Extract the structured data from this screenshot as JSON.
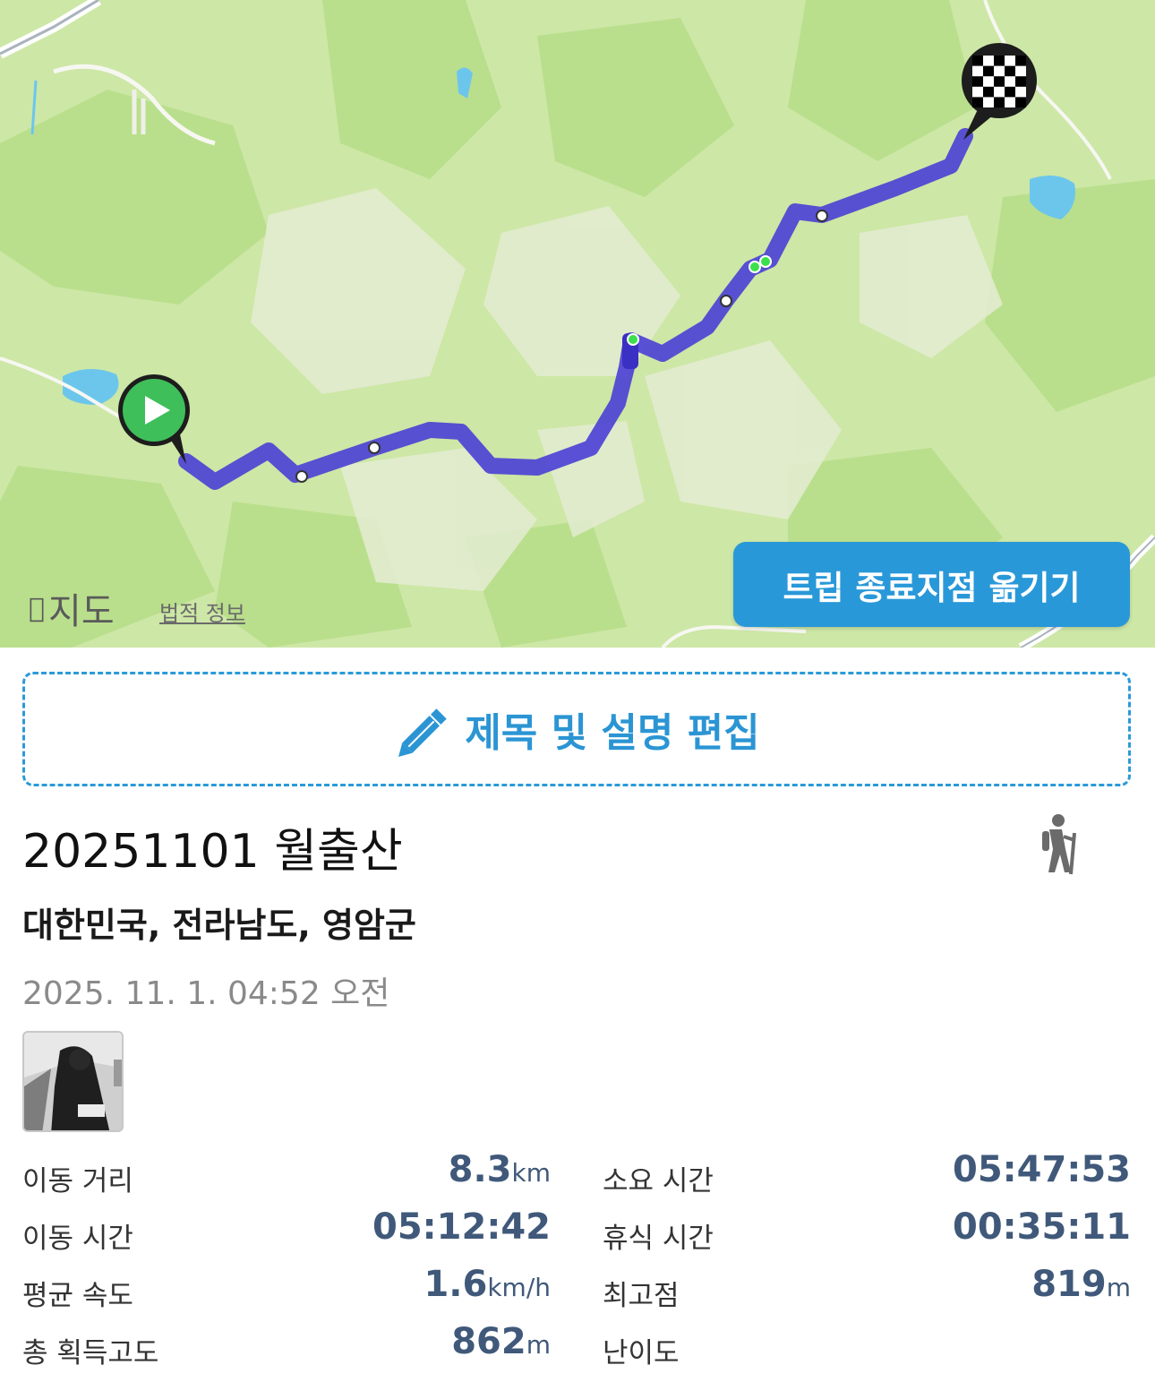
{
  "map": {
    "logo_text": "지도",
    "legal_link": "법적 정보",
    "move_end_button": "트립 종료지점 옮기기",
    "route_color": "#4a3fd6",
    "start_marker_color": "#3fbf5a"
  },
  "edit_button": {
    "label": "제목 및 설명 편집",
    "color": "#2b95d4"
  },
  "trip": {
    "title": "20251101 월출산",
    "location": "대한민국, 전라남도, 영암군",
    "datetime": "2025. 11. 1. 04:52 오전",
    "activity_icon": "hiker-icon"
  },
  "stats": {
    "left": [
      {
        "label": "이동 거리",
        "value": "8.3",
        "unit": "km"
      },
      {
        "label": "이동 시간",
        "value": "05:12:42",
        "unit": ""
      },
      {
        "label": "평균 속도",
        "value": "1.6",
        "unit": "km/h"
      },
      {
        "label": "총 획득고도",
        "value": "862",
        "unit": "m"
      }
    ],
    "right": [
      {
        "label": "소요 시간",
        "value": "05:47:53",
        "unit": ""
      },
      {
        "label": "휴식 시간",
        "value": "00:35:11",
        "unit": ""
      },
      {
        "label": "최고점",
        "value": "819",
        "unit": "m"
      },
      {
        "label": "난이도",
        "value": "",
        "unit": ""
      }
    ]
  }
}
